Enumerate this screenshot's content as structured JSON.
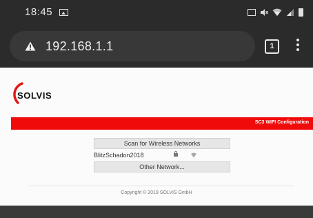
{
  "status_bar": {
    "time": "18:45",
    "icons": [
      "gallery-icon",
      "nfc-icon",
      "mute-icon",
      "wifi-icon",
      "signal-icon",
      "battery-icon"
    ]
  },
  "browser": {
    "url": "192.168.1.1",
    "tab_count": "1",
    "security_icon": "warning-icon",
    "menu_icon": "overflow-menu-icon"
  },
  "page": {
    "logo_text": "SOLVIS",
    "banner_text": "SC3 WIFI Configuration",
    "scan_button": "Scan for Wireless Networks",
    "networks": [
      {
        "ssid": "BlitzSchadon2018",
        "secured": true
      }
    ],
    "other_network_button": "Other Network...",
    "footer": "Copyright © 2019 SOLVIS GmbH"
  },
  "colors": {
    "banner": "#f00a0a",
    "logo_arc": "#e01818",
    "browser_chrome": "#2b2b2b"
  }
}
